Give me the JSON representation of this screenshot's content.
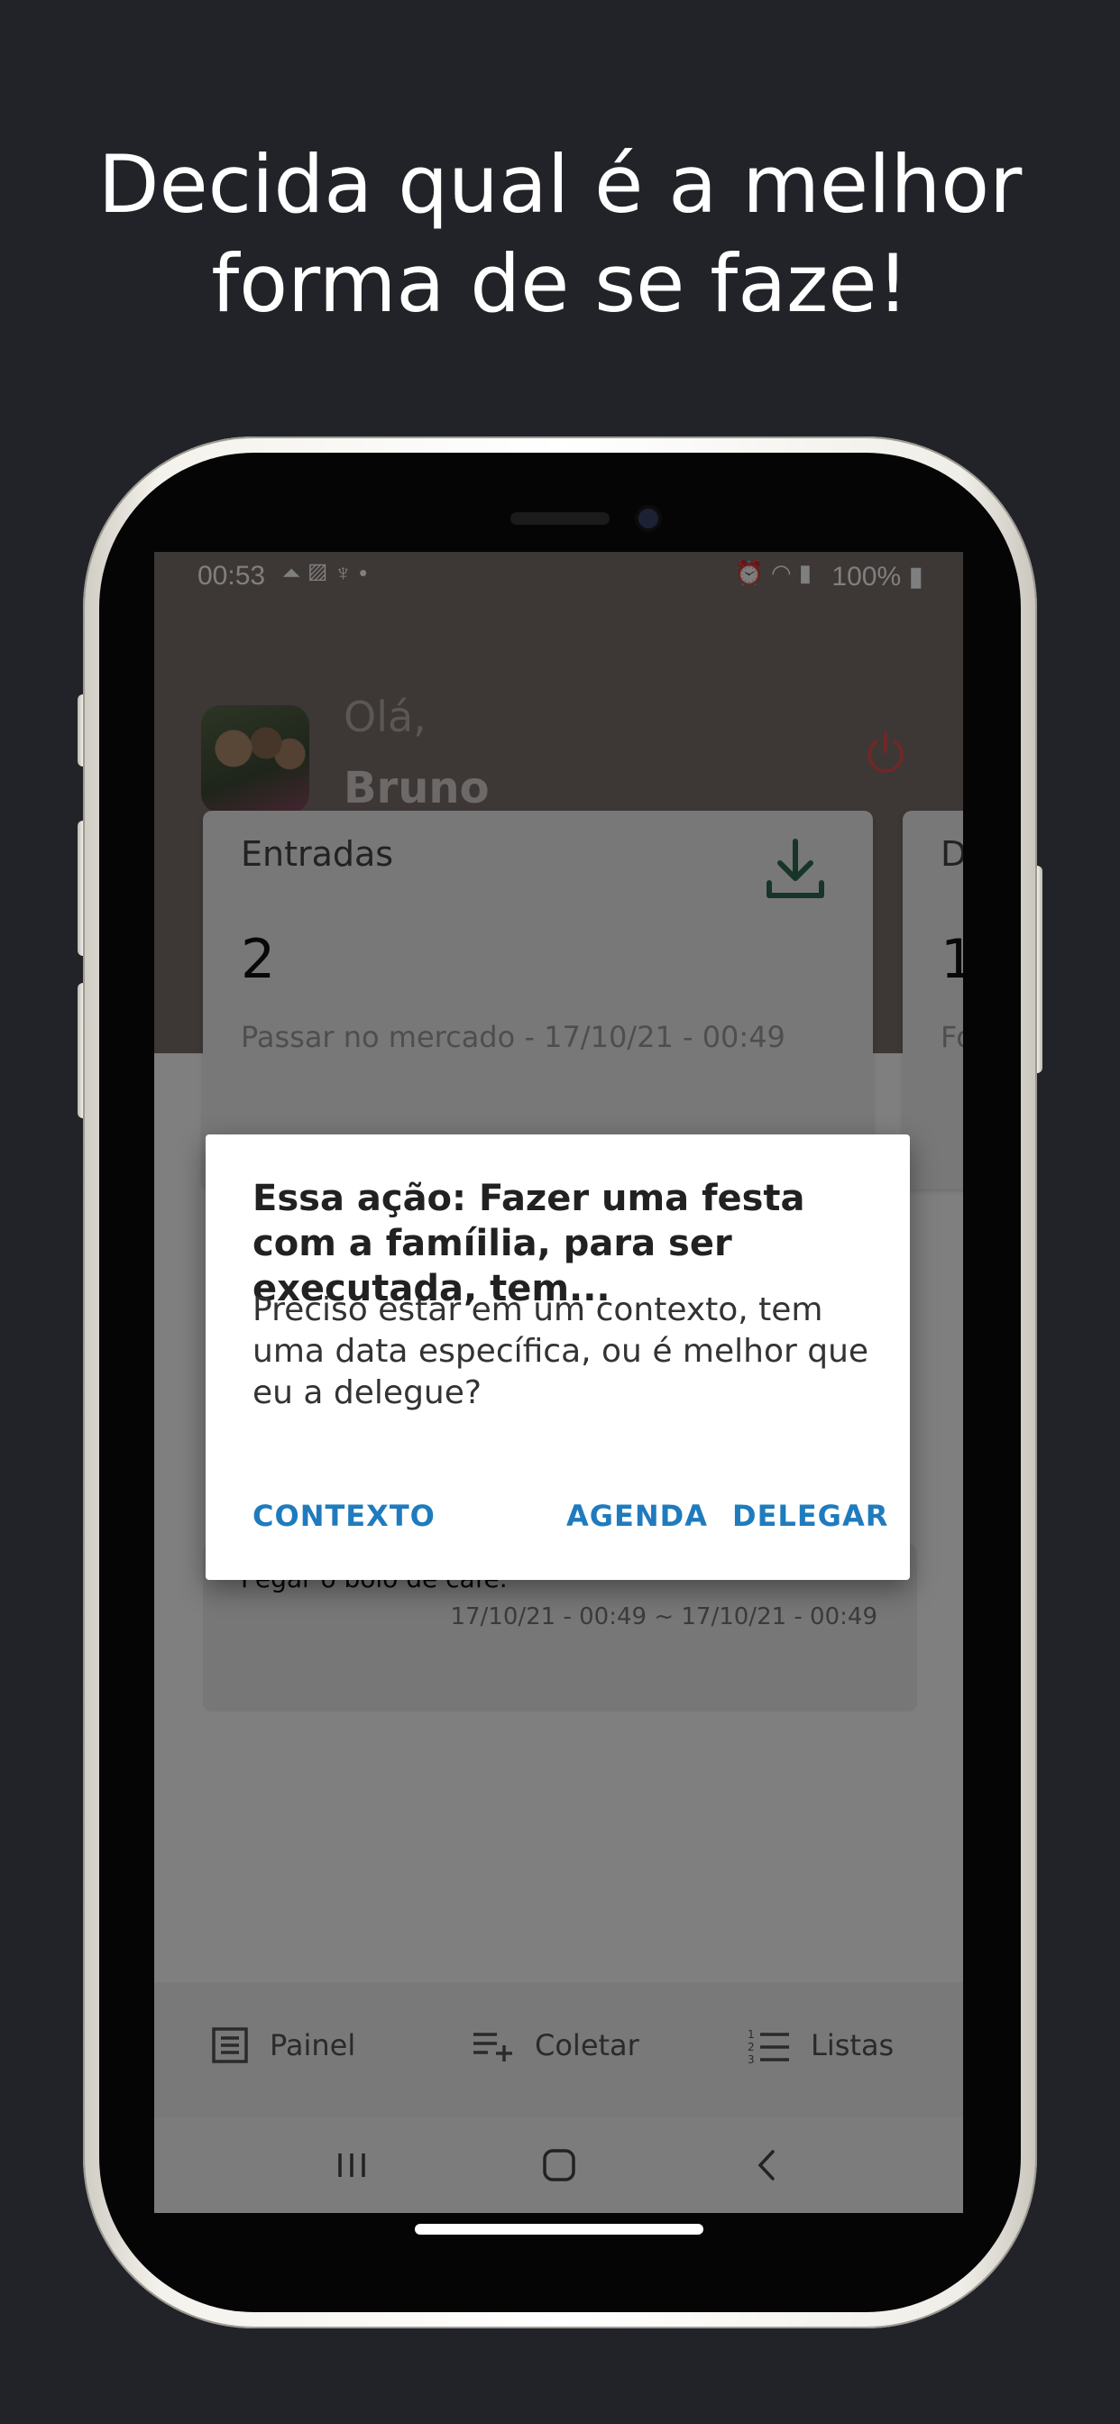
{
  "headline": {
    "line1": "Decida qual é a melhor",
    "line2": "forma de se faze!"
  },
  "status_bar": {
    "time": "00:53",
    "left_icons": [
      "app-icon",
      "image-icon",
      "person-icon",
      "dot-icon"
    ],
    "right_icons": [
      "alarm-icon",
      "wifi-icon",
      "signal-icon"
    ],
    "battery": "100%"
  },
  "header": {
    "greeting": "Olá,",
    "user_name": "Bruno"
  },
  "cards": [
    {
      "title": "Entradas",
      "count": "2",
      "subtitle": "Passar no mercado - 17/10/21 - 00:49"
    },
    {
      "title": "D",
      "count": "1",
      "subtitle": "Fo"
    }
  ],
  "list_item": {
    "text": "Pegar o bolo de café.",
    "date": "17/10/21 - 00:49 ~ 17/10/21 - 00:49"
  },
  "dialog": {
    "title": "Essa ação: Fazer uma festa com a famíilia, para ser executada, tem...",
    "message": "Preciso estar em um contexto, tem uma data específica, ou é melhor que eu a delegue?",
    "buttons": {
      "context": "CONTEXTO",
      "schedule": "AGENDA",
      "delegate": "DELEGAR"
    },
    "accent_color": "#1f7bbd"
  },
  "bottom_nav": {
    "items": [
      {
        "label": "Painel",
        "icon": "dashboard-icon"
      },
      {
        "label": "Coletar",
        "icon": "playlist-add-icon"
      },
      {
        "label": "Listas",
        "icon": "list-icon"
      }
    ]
  },
  "colors": {
    "page_background": "#212328",
    "header_background": "#7a6f6c",
    "power_icon": "#d9534f",
    "download_icon": "#2e6b52"
  }
}
